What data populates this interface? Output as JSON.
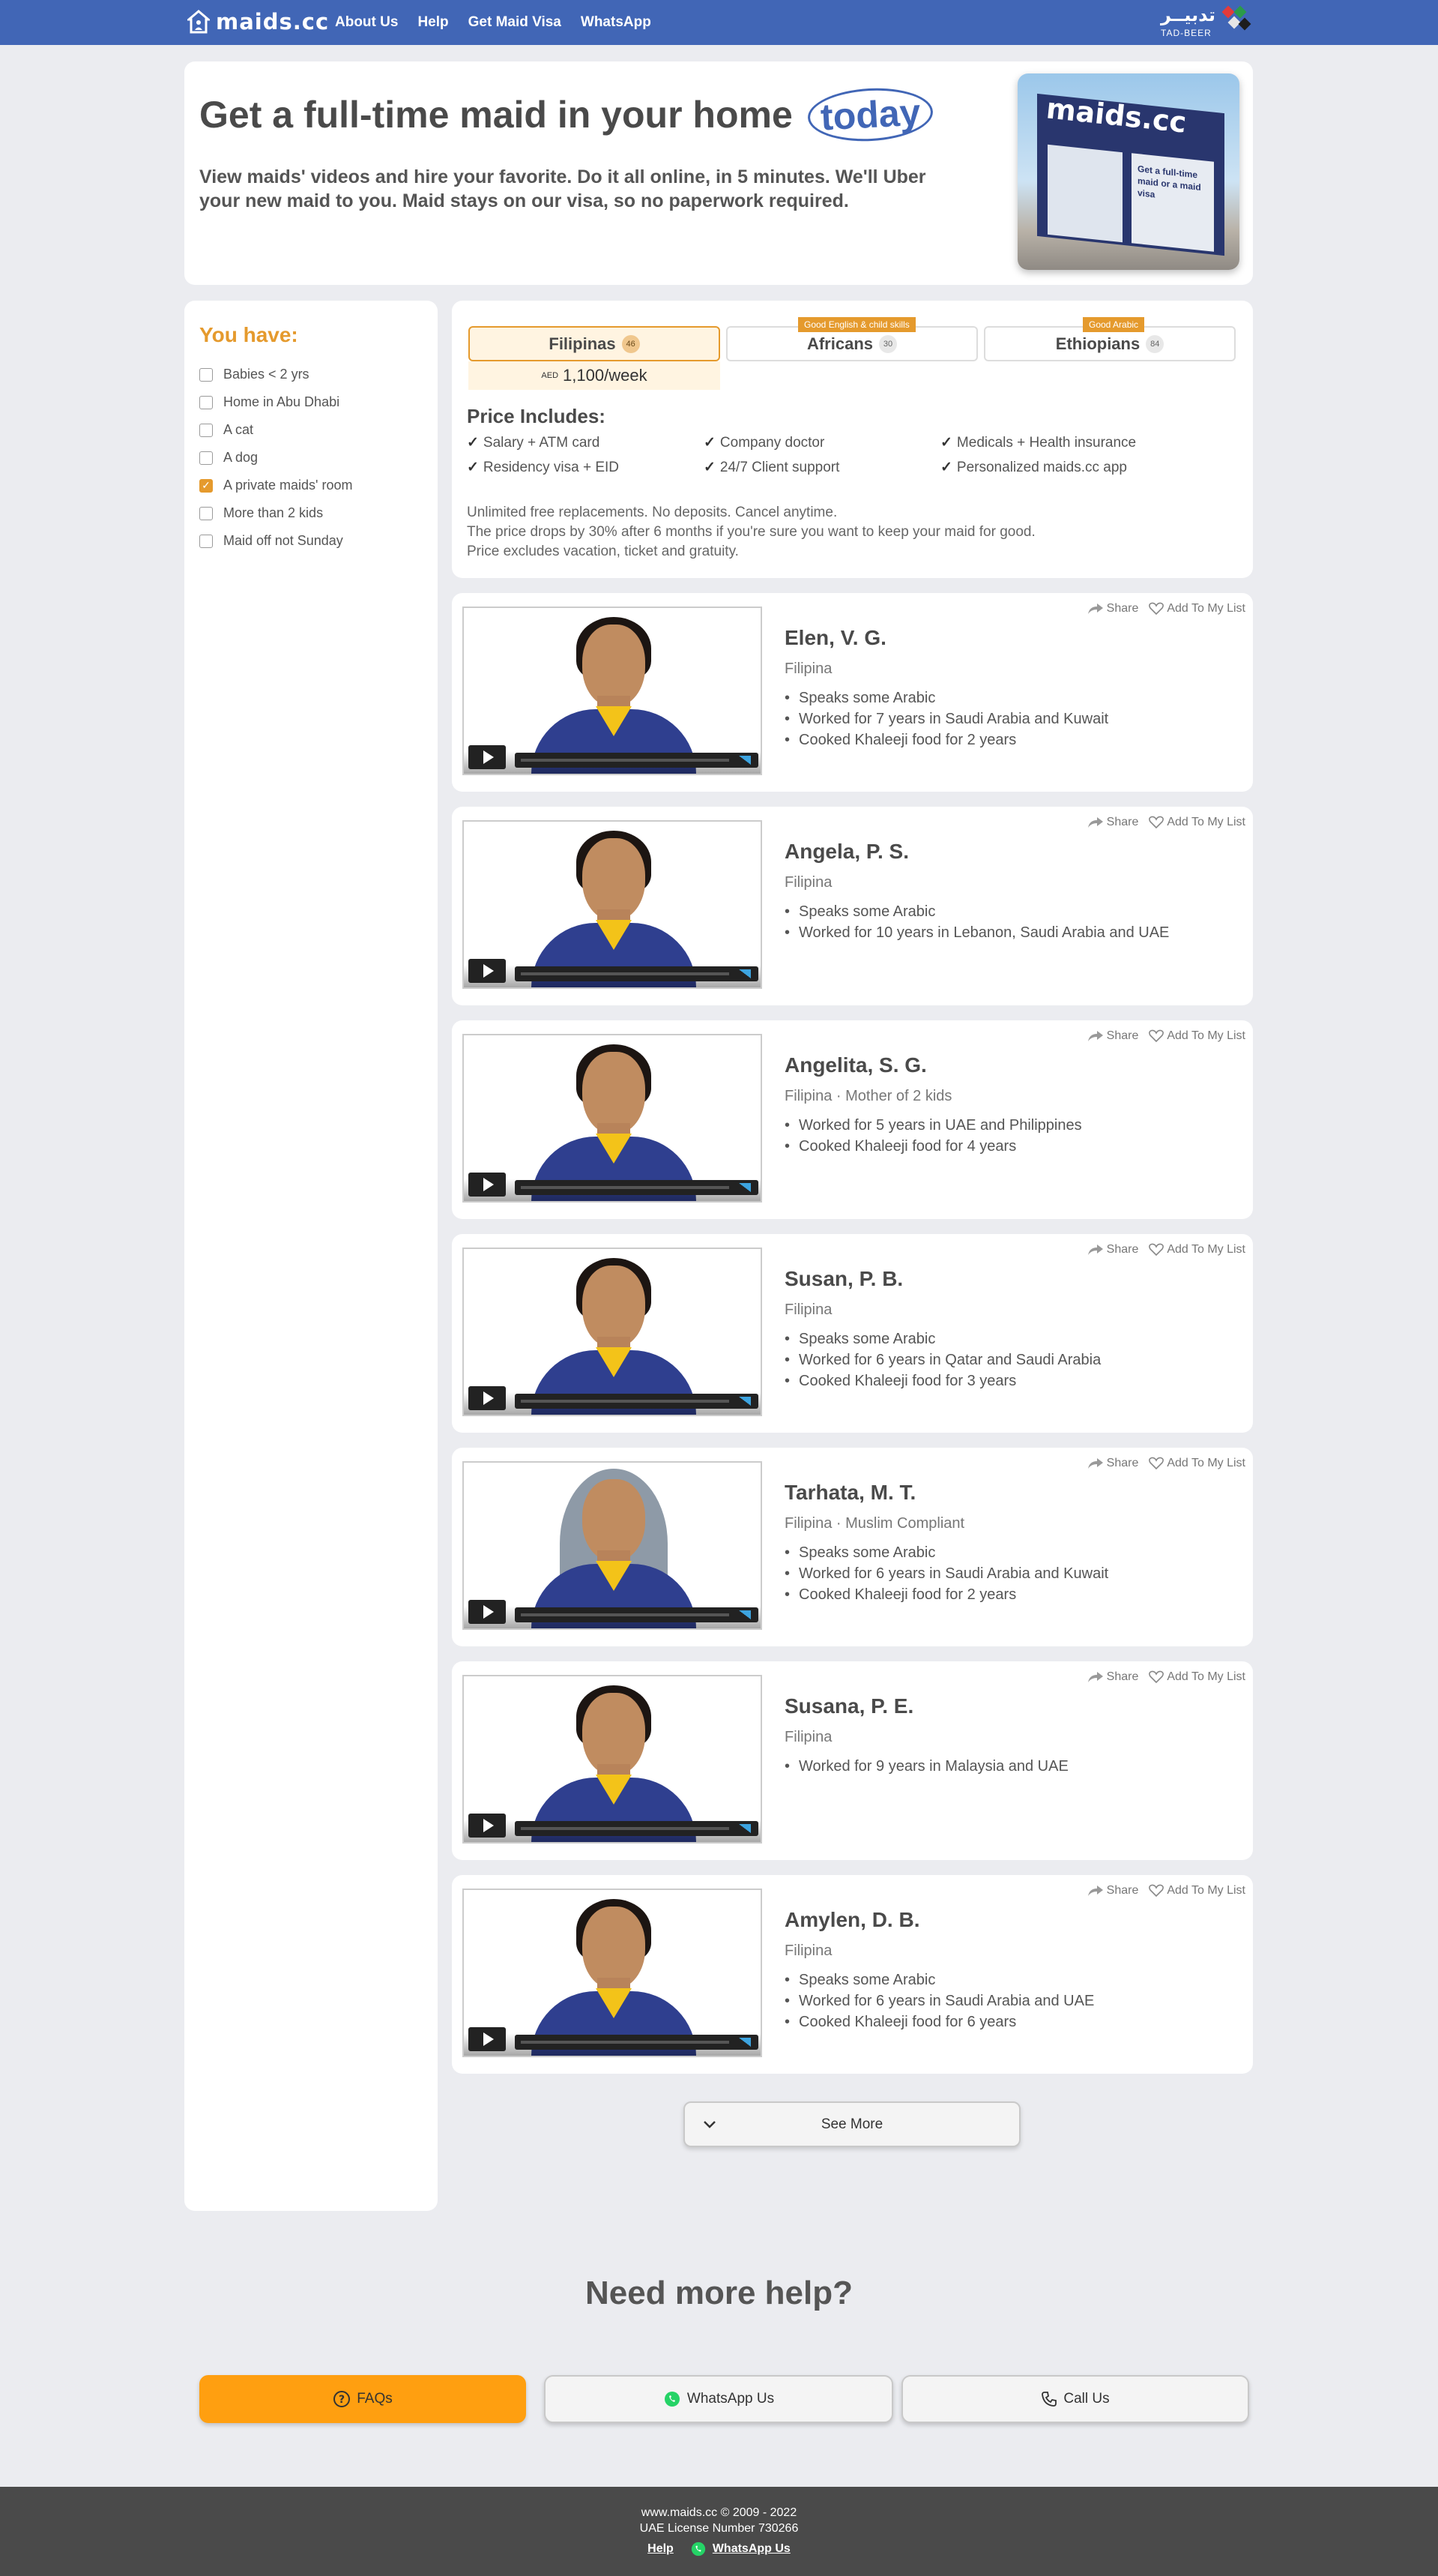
{
  "nav": {
    "brand": "maids.cc",
    "links": [
      "About Us",
      "Help",
      "Get Maid Visa",
      "WhatsApp"
    ],
    "partner_ar": "تدبيــر",
    "partner_en": "TAD-BEER"
  },
  "hero": {
    "title": "Get a full-time maid in your home",
    "title_highlight": "today",
    "subtitle": "View maids' videos and hire your favorite. Do it all online, in 5 minutes. We'll Uber your new maid to you. Maid stays on our visa, so no paperwork required.",
    "image_sign": "maids.cc",
    "image_window_text": "Get a full-time maid or a maid visa"
  },
  "sidebar": {
    "title": "You have:",
    "items": [
      {
        "label": "Babies < 2 yrs",
        "checked": false
      },
      {
        "label": "Home in Abu Dhabi",
        "checked": false
      },
      {
        "label": "A cat",
        "checked": false
      },
      {
        "label": "A dog",
        "checked": false
      },
      {
        "label": "A private maids' room",
        "checked": true
      },
      {
        "label": "More than 2 kids",
        "checked": false
      },
      {
        "label": "Maid off not Sunday",
        "checked": false
      }
    ]
  },
  "tabs": [
    {
      "label": "Filipinas",
      "count": "46",
      "tag": "",
      "active": true
    },
    {
      "label": "Africans",
      "count": "30",
      "tag": "Good English & child skills",
      "active": false
    },
    {
      "label": "Ethiopians",
      "count": "84",
      "tag": "Good Arabic",
      "active": false
    }
  ],
  "price": {
    "currency": "AED",
    "value": "1,100/week"
  },
  "price_includes": {
    "title": "Price Includes:",
    "items": [
      "Salary + ATM card",
      "Company doctor",
      "Medicals + Health insurance",
      "Residency visa + EID",
      "24/7 Client support",
      "Personalized maids.cc app"
    ],
    "notes": [
      "Unlimited free replacements. No deposits. Cancel anytime.",
      "The price drops by 30% after 6 months if you're sure you want to keep your maid for good.",
      "Price excludes vacation, ticket and gratuity."
    ]
  },
  "card_actions": {
    "share": "Share",
    "add": "Add To My List"
  },
  "maids": [
    {
      "name": "Elen, V. G.",
      "meta": "Filipina",
      "bullets": [
        "Speaks some Arabic",
        "Worked for 7 years in Saudi Arabia and Kuwait",
        "Cooked Khaleeji food for 2 years"
      ],
      "hijab": false
    },
    {
      "name": "Angela, P. S.",
      "meta": "Filipina",
      "bullets": [
        "Speaks some Arabic",
        "Worked for 10 years in Lebanon, Saudi Arabia and UAE"
      ],
      "hijab": false
    },
    {
      "name": "Angelita, S. G.",
      "meta": "Filipina · Mother of 2 kids",
      "bullets": [
        "Worked for 5 years in UAE and Philippines",
        "Cooked Khaleeji food for 4 years"
      ],
      "hijab": false
    },
    {
      "name": "Susan, P. B.",
      "meta": "Filipina",
      "bullets": [
        "Speaks some Arabic",
        "Worked for 6 years in Qatar and Saudi Arabia",
        "Cooked Khaleeji food for 3 years"
      ],
      "hijab": false
    },
    {
      "name": "Tarhata, M. T.",
      "meta": "Filipina · Muslim Compliant",
      "bullets": [
        "Speaks some Arabic",
        "Worked for 6 years in Saudi Arabia and Kuwait",
        "Cooked Khaleeji food for 2 years"
      ],
      "hijab": true
    },
    {
      "name": "Susana, P. E.",
      "meta": "Filipina",
      "bullets": [
        "Worked for 9 years in Malaysia and UAE"
      ],
      "hijab": false
    },
    {
      "name": "Amylen, D. B.",
      "meta": "Filipina",
      "bullets": [
        "Speaks some Arabic",
        "Worked for 6 years in Saudi Arabia and UAE",
        "Cooked Khaleeji food for 6 years"
      ],
      "hijab": false
    }
  ],
  "see_more": "See More",
  "help": {
    "title": "Need more help?",
    "faq": "FAQs",
    "whatsapp": "WhatsApp Us",
    "call": "Call Us"
  },
  "footer": {
    "copyright": "www.maids.cc © 2009 - 2022",
    "license": "UAE License Number 730266",
    "help": "Help",
    "whatsapp": "WhatsApp Us"
  }
}
